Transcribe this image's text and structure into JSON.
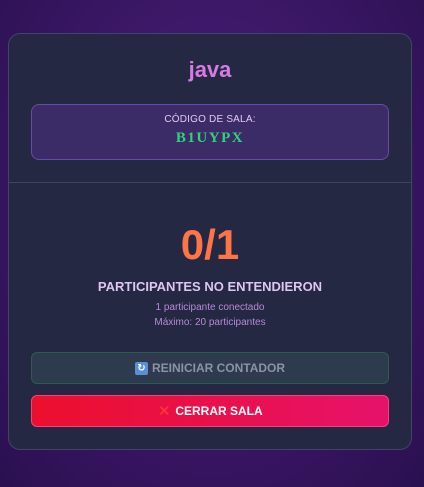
{
  "room": {
    "name": "java",
    "code_label": "CÓDIGO DE SALA:",
    "code": "B1UYPX"
  },
  "counter": {
    "value": "0/1",
    "label": "PARTICIPANTES NO ENTENDIERON",
    "connected": "1 participante conectado",
    "max": "Máximo: 20 participantes"
  },
  "actions": {
    "reset_label": "REINICIAR CONTADOR",
    "reset_icon": "refresh-icon",
    "close_label": "CERRAR SALA",
    "close_icon": "cross-mark-icon"
  },
  "colors": {
    "room_name": "#d47ce3",
    "code": "#33d17a",
    "counter": "#ff7446",
    "close_button": "#ec0f2d"
  }
}
